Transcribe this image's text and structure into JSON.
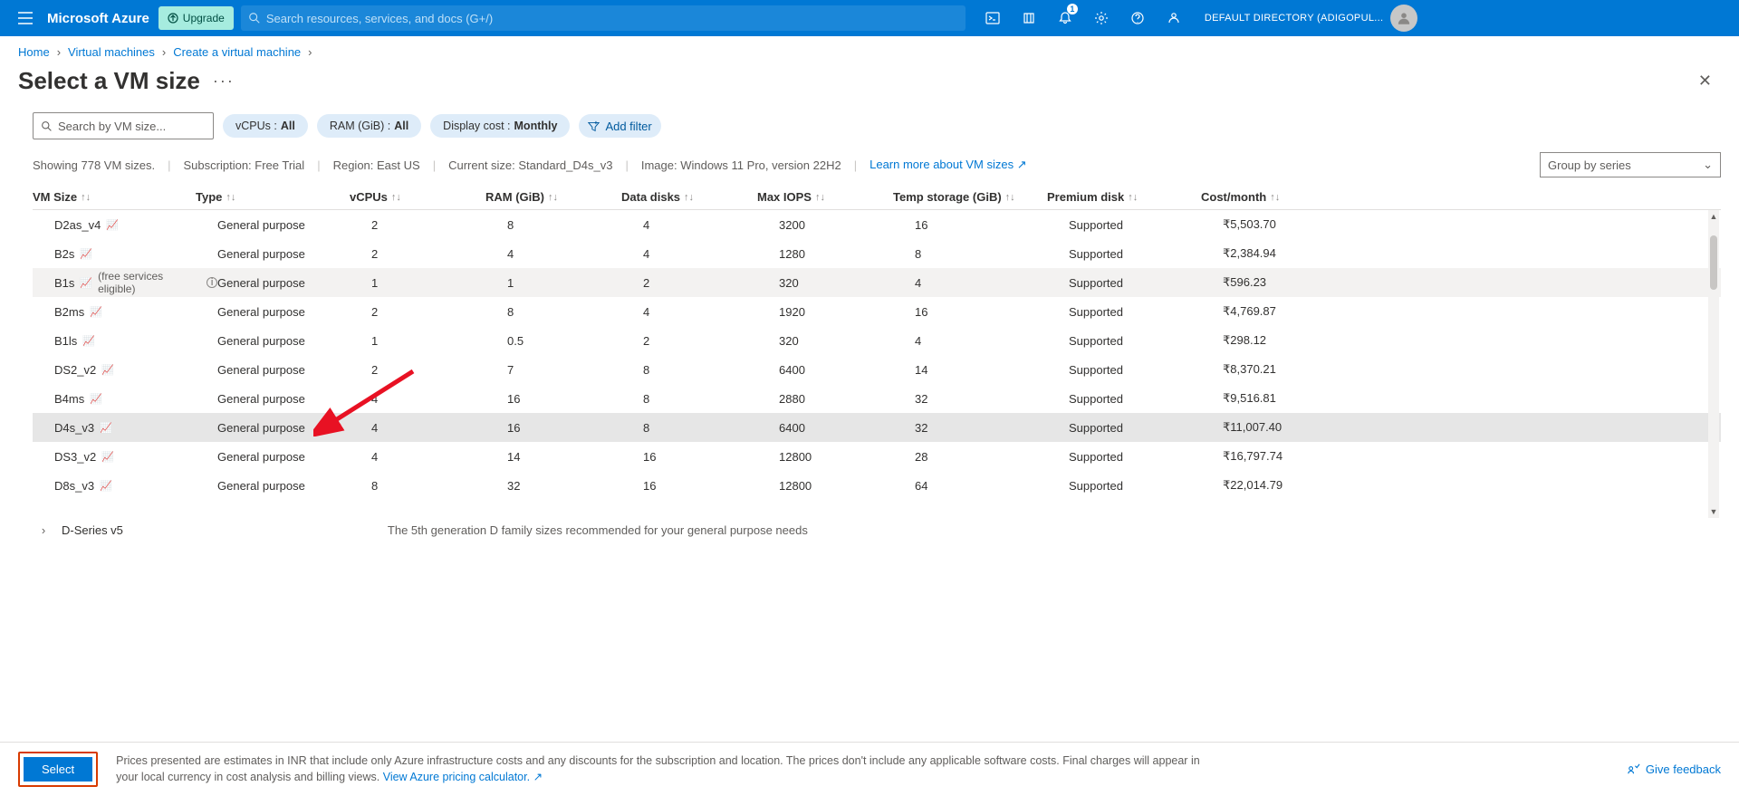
{
  "topbar": {
    "brand": "Microsoft Azure",
    "upgrade": "Upgrade",
    "search_placeholder": "Search resources, services, and docs (G+/)",
    "notif_badge": "1",
    "tenant": "DEFAULT DIRECTORY (ADIGOPUL..."
  },
  "breadcrumb": {
    "home": "Home",
    "vm": "Virtual machines",
    "create": "Create a virtual machine"
  },
  "page": {
    "title": "Select a VM size"
  },
  "filters": {
    "search_placeholder": "Search by VM size...",
    "vcpus_label": "vCPUs : ",
    "vcpus_value": "All",
    "ram_label": "RAM (GiB) : ",
    "ram_value": "All",
    "cost_label": "Display cost : ",
    "cost_value": "Monthly",
    "add_filter": "Add filter"
  },
  "status": {
    "showing": "Showing 778 VM sizes.",
    "subscription": "Subscription: Free Trial",
    "region": "Region: East US",
    "current": "Current size: Standard_D4s_v3",
    "image": "Image: Windows 11 Pro, version 22H2",
    "learn": "Learn more about VM sizes",
    "groupby": "Group by series"
  },
  "columns": {
    "c0": "VM Size",
    "c1": "Type",
    "c2": "vCPUs",
    "c3": "RAM (GiB)",
    "c4": "Data disks",
    "c5": "Max IOPS",
    "c6": "Temp storage (GiB)",
    "c7": "Premium disk",
    "c8": "Cost/month"
  },
  "rows": [
    {
      "name": "D2as_v4",
      "type": "General purpose",
      "vcpus": "2",
      "ram": "8",
      "disks": "4",
      "iops": "3200",
      "temp": "16",
      "prem": "Supported",
      "cost": "₹5,503.70",
      "free": false
    },
    {
      "name": "B2s",
      "type": "General purpose",
      "vcpus": "2",
      "ram": "4",
      "disks": "4",
      "iops": "1280",
      "temp": "8",
      "prem": "Supported",
      "cost": "₹2,384.94",
      "free": false
    },
    {
      "name": "B1s",
      "type": "General purpose",
      "vcpus": "1",
      "ram": "1",
      "disks": "2",
      "iops": "320",
      "temp": "4",
      "prem": "Supported",
      "cost": "₹596.23",
      "free": true,
      "free_text": "(free services eligible)"
    },
    {
      "name": "B2ms",
      "type": "General purpose",
      "vcpus": "2",
      "ram": "8",
      "disks": "4",
      "iops": "1920",
      "temp": "16",
      "prem": "Supported",
      "cost": "₹4,769.87",
      "free": false
    },
    {
      "name": "B1ls",
      "type": "General purpose",
      "vcpus": "1",
      "ram": "0.5",
      "disks": "2",
      "iops": "320",
      "temp": "4",
      "prem": "Supported",
      "cost": "₹298.12",
      "free": false
    },
    {
      "name": "DS2_v2",
      "type": "General purpose",
      "vcpus": "2",
      "ram": "7",
      "disks": "8",
      "iops": "6400",
      "temp": "14",
      "prem": "Supported",
      "cost": "₹8,370.21",
      "free": false
    },
    {
      "name": "B4ms",
      "type": "General purpose",
      "vcpus": "4",
      "ram": "16",
      "disks": "8",
      "iops": "2880",
      "temp": "32",
      "prem": "Supported",
      "cost": "₹9,516.81",
      "free": false
    },
    {
      "name": "D4s_v3",
      "type": "General purpose",
      "vcpus": "4",
      "ram": "16",
      "disks": "8",
      "iops": "6400",
      "temp": "32",
      "prem": "Supported",
      "cost": "₹11,007.40",
      "free": false,
      "selected": true
    },
    {
      "name": "DS3_v2",
      "type": "General purpose",
      "vcpus": "4",
      "ram": "14",
      "disks": "16",
      "iops": "12800",
      "temp": "28",
      "prem": "Supported",
      "cost": "₹16,797.74",
      "free": false
    },
    {
      "name": "D8s_v3",
      "type": "General purpose",
      "vcpus": "8",
      "ram": "32",
      "disks": "16",
      "iops": "12800",
      "temp": "64",
      "prem": "Supported",
      "cost": "₹22,014.79",
      "free": false
    }
  ],
  "series": {
    "name": "D-Series v5",
    "desc": "The 5th generation D family sizes recommended for your general purpose needs"
  },
  "footer": {
    "select": "Select",
    "text": "Prices presented are estimates in INR that include only Azure infrastructure costs and any discounts for the subscription and location. The prices don't include any applicable software costs. Final charges will appear in your local currency in cost analysis and billing views.  ",
    "calc_link": "View Azure pricing calculator.",
    "feedback": "Give feedback"
  }
}
